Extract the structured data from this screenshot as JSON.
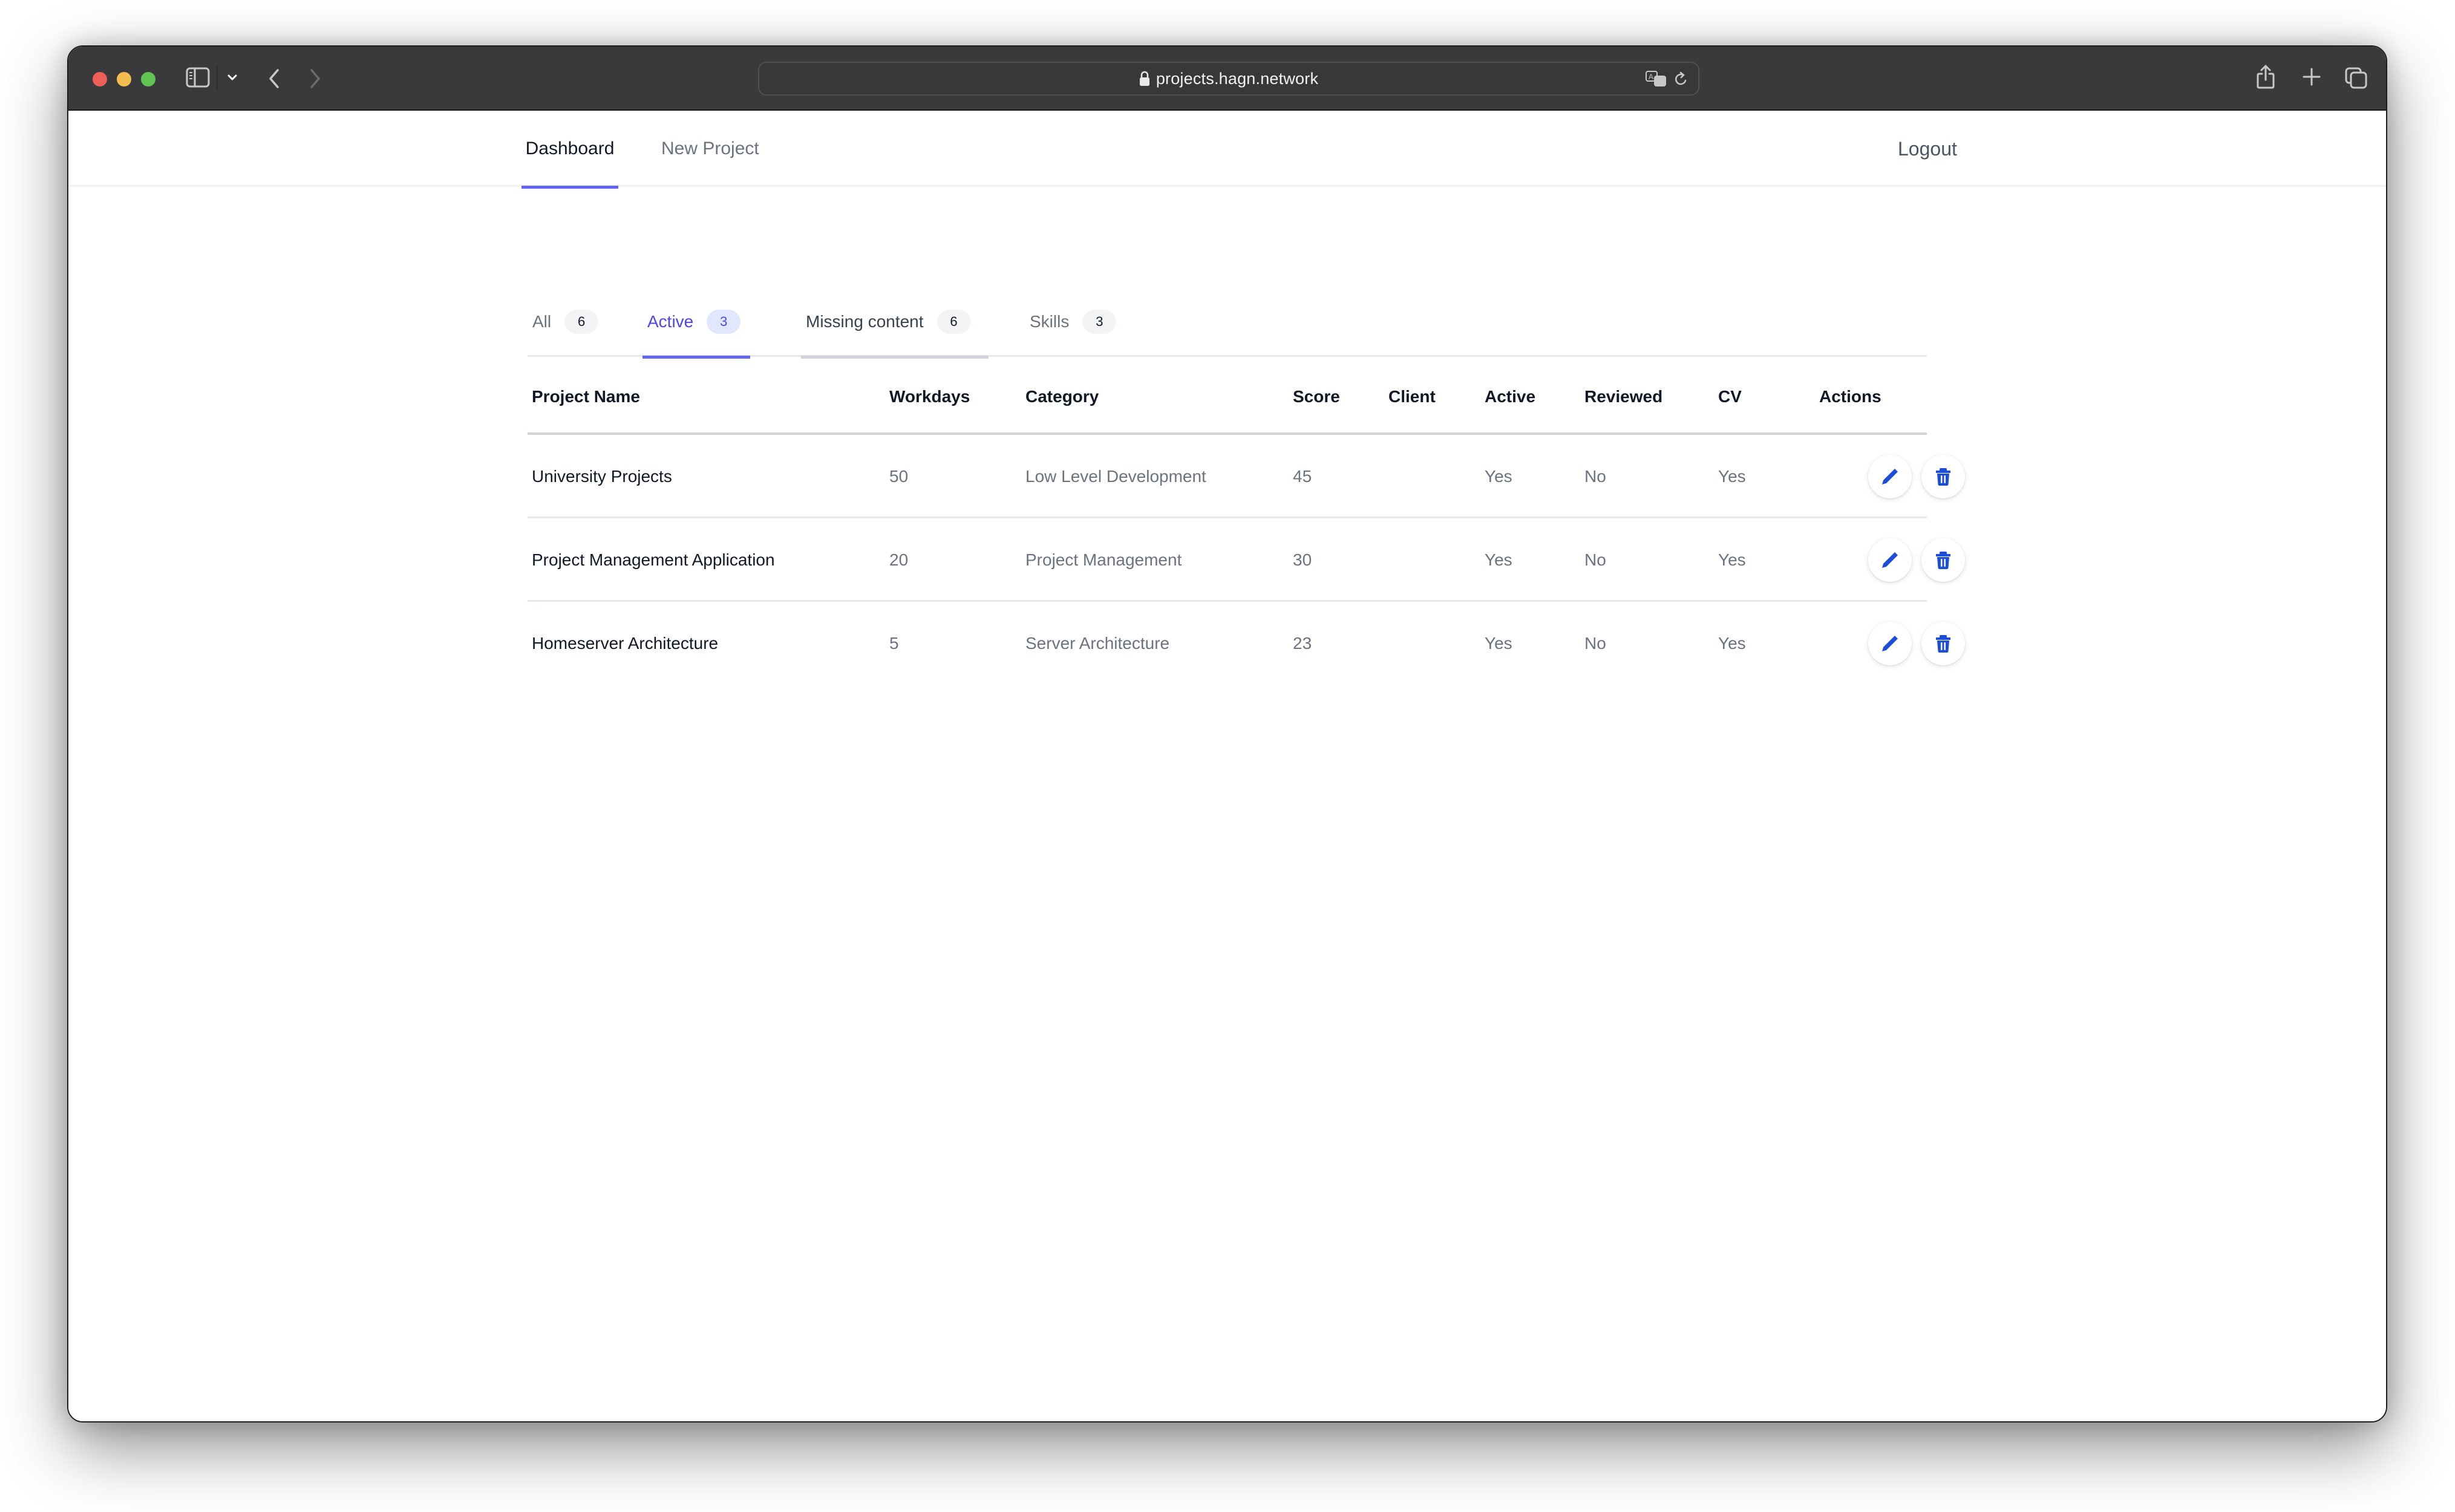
{
  "browser": {
    "url": "projects.hagn.network",
    "icons": {
      "sidebar": "sidebar-icon",
      "chevron": "chevron-down-icon",
      "back": "chevron-left-icon",
      "forward": "chevron-right-icon",
      "lock": "lock-icon",
      "translate": "translate-icon",
      "reload": "reload-icon",
      "share": "share-icon",
      "new_tab": "plus-icon",
      "tab_overview": "tabs-icon"
    }
  },
  "nav": {
    "links": [
      {
        "label": "Dashboard",
        "active": true
      },
      {
        "label": "New Project",
        "active": false
      }
    ],
    "logout": "Logout",
    "accent_color": "#6366f1"
  },
  "filters": {
    "tabs": [
      {
        "label": "All",
        "count": "6",
        "state": "default"
      },
      {
        "label": "Active",
        "count": "3",
        "state": "active"
      },
      {
        "label": "Missing content",
        "count": "6",
        "state": "hover"
      },
      {
        "label": "Skills",
        "count": "3",
        "state": "default"
      }
    ]
  },
  "table": {
    "columns": [
      "Project Name",
      "Workdays",
      "Category",
      "Score",
      "Client",
      "Active",
      "Reviewed",
      "CV",
      "Actions"
    ],
    "rows": [
      {
        "name": "University Projects",
        "workdays": "50",
        "category": "Low Level Development",
        "score": "45",
        "client": "",
        "active": "Yes",
        "reviewed": "No",
        "cv": "Yes"
      },
      {
        "name": "Project Management Application",
        "workdays": "20",
        "category": "Project Management",
        "score": "30",
        "client": "",
        "active": "Yes",
        "reviewed": "No",
        "cv": "Yes"
      },
      {
        "name": "Homeserver Architecture",
        "workdays": "5",
        "category": "Server Architecture",
        "score": "23",
        "client": "",
        "active": "Yes",
        "reviewed": "No",
        "cv": "Yes"
      }
    ],
    "row_actions": [
      {
        "name": "edit",
        "icon": "pencil-icon"
      },
      {
        "name": "delete",
        "icon": "trash-icon"
      }
    ],
    "action_color": "#1d4ed8"
  }
}
